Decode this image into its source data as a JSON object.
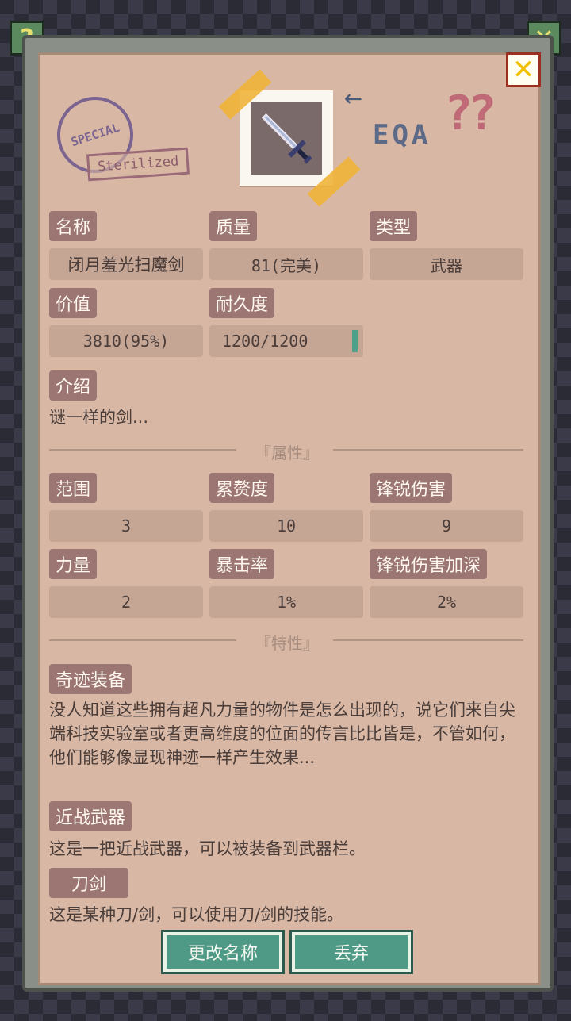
{
  "header": {
    "help_glyph": "?",
    "close_glyph": "✕",
    "stamp_circle_text": "SPECIAL",
    "stamp_sterilized": "Sterilized",
    "stamp_eqa": "EQA",
    "question_marks": "??",
    "arrow_glyph": "←"
  },
  "item": {
    "name_label": "名称",
    "name_value": "闭月羞光扫魔剑",
    "quality_label": "质量",
    "quality_value": "81(完美)",
    "type_label": "类型",
    "type_value": "武器",
    "price_label": "价值",
    "price_value": "3810(95%)",
    "durability_label": "耐久度",
    "durability_value": "1200/1200",
    "intro_label": "介绍",
    "intro_text": "谜一样的剑..."
  },
  "attributes": {
    "section_title": "『属性』",
    "stats": [
      {
        "label": "范围",
        "value": "3"
      },
      {
        "label": "累赘度",
        "value": "10"
      },
      {
        "label": "锋锐伤害",
        "value": "9"
      },
      {
        "label": "力量",
        "value": "2"
      },
      {
        "label": "暴击率",
        "value": "1%"
      },
      {
        "label": "锋锐伤害加深",
        "value": "2%"
      }
    ]
  },
  "traits": {
    "section_title": "『特性』",
    "items": [
      {
        "label": "奇迹装备",
        "text": "没人知道这些拥有超凡力量的物件是怎么出现的，说它们来自尖端科技实验室或者更高维度的位面的传言比比皆是，不管如何，他们能够像显现神迹一样产生效果..."
      },
      {
        "label": "近战武器",
        "text": "这是一把近战武器，可以被装备到武器栏。"
      },
      {
        "label": "刀剑",
        "text": "这是某种刀/剑，可以使用刀/剑的技能。"
      }
    ]
  },
  "actions": {
    "rename_label": "更改名称",
    "discard_label": "丢弃"
  },
  "colors": {
    "panel_bg": "#d8b8a4",
    "label_bg": "#9c7672",
    "value_bg": "#c5a594",
    "button_bg": "#4f9a86",
    "close_accent": "#f0c000"
  },
  "icons": {
    "item_icon": "sword-icon"
  }
}
